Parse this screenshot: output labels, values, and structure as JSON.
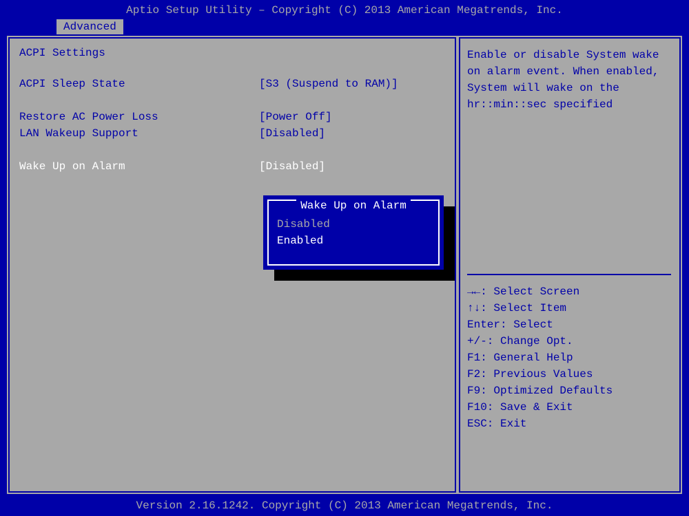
{
  "header": {
    "title": "Aptio Setup Utility – Copyright (C) 2013 American Megatrends, Inc."
  },
  "tabs": {
    "active": "Advanced"
  },
  "main": {
    "section_title": "ACPI Settings",
    "settings": [
      {
        "label": "ACPI Sleep State",
        "value": "[S3 (Suspend to RAM)]"
      },
      {
        "label": "Restore AC Power Loss",
        "value": "[Power Off]"
      },
      {
        "label": "LAN Wakeup Support",
        "value": "[Disabled]"
      },
      {
        "label": "Wake Up on Alarm",
        "value": "[Disabled]"
      }
    ]
  },
  "popup": {
    "title": "Wake Up on Alarm",
    "options": [
      "Disabled",
      "Enabled"
    ],
    "selected_index": 1
  },
  "help": {
    "text_lines": [
      "Enable or disable System wake",
      "on alarm event. When enabled,",
      "System will wake on the",
      "hr::min::sec specified"
    ],
    "keys": [
      {
        "sym": "→←: ",
        "label": "Select Screen"
      },
      {
        "sym": "↑↓: ",
        "label": "Select Item"
      },
      {
        "sym": "Enter: ",
        "label": "Select"
      },
      {
        "sym": "+/-: ",
        "label": "Change Opt."
      },
      {
        "sym": "F1: ",
        "label": "General Help"
      },
      {
        "sym": "F2: ",
        "label": "Previous Values"
      },
      {
        "sym": "F9: ",
        "label": "Optimized Defaults"
      },
      {
        "sym": "F10: ",
        "label": "Save & Exit"
      },
      {
        "sym": "ESC: ",
        "label": "Exit"
      }
    ]
  },
  "footer": {
    "text": "Version 2.16.1242. Copyright (C) 2013 American Megatrends, Inc."
  }
}
